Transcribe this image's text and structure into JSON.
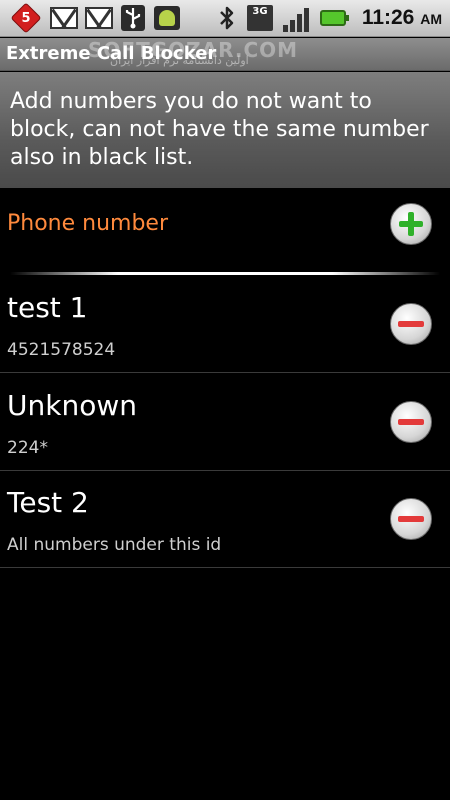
{
  "status_bar": {
    "notification_count": "5",
    "time": "11:26",
    "ampm": "AM",
    "network_type": "3G",
    "icons": [
      "notification-badge-icon",
      "gmail-icon",
      "gmail-icon",
      "usb-icon",
      "android-debug-icon",
      "bluetooth-icon",
      "network-3g-icon",
      "signal-icon",
      "battery-icon"
    ]
  },
  "app": {
    "title": "Extreme Call Blocker",
    "watermark": "SOFTGOZAR.COM",
    "watermark_fa": "اولین دانشنامه نرم افزار ایران"
  },
  "description": "Add numbers you do not want to block, can not have the same number also in black list.",
  "list_header": {
    "label": "Phone number",
    "add_icon": "plus-icon",
    "accent_color": "#ff8a3d"
  },
  "entries": [
    {
      "name": "test 1",
      "detail": "4521578524"
    },
    {
      "name": "Unknown",
      "detail": "224*"
    },
    {
      "name": "Test 2",
      "detail": "All numbers under this id"
    }
  ],
  "colors": {
    "add_green": "#2fb12a",
    "remove_red": "#e33a3a"
  }
}
